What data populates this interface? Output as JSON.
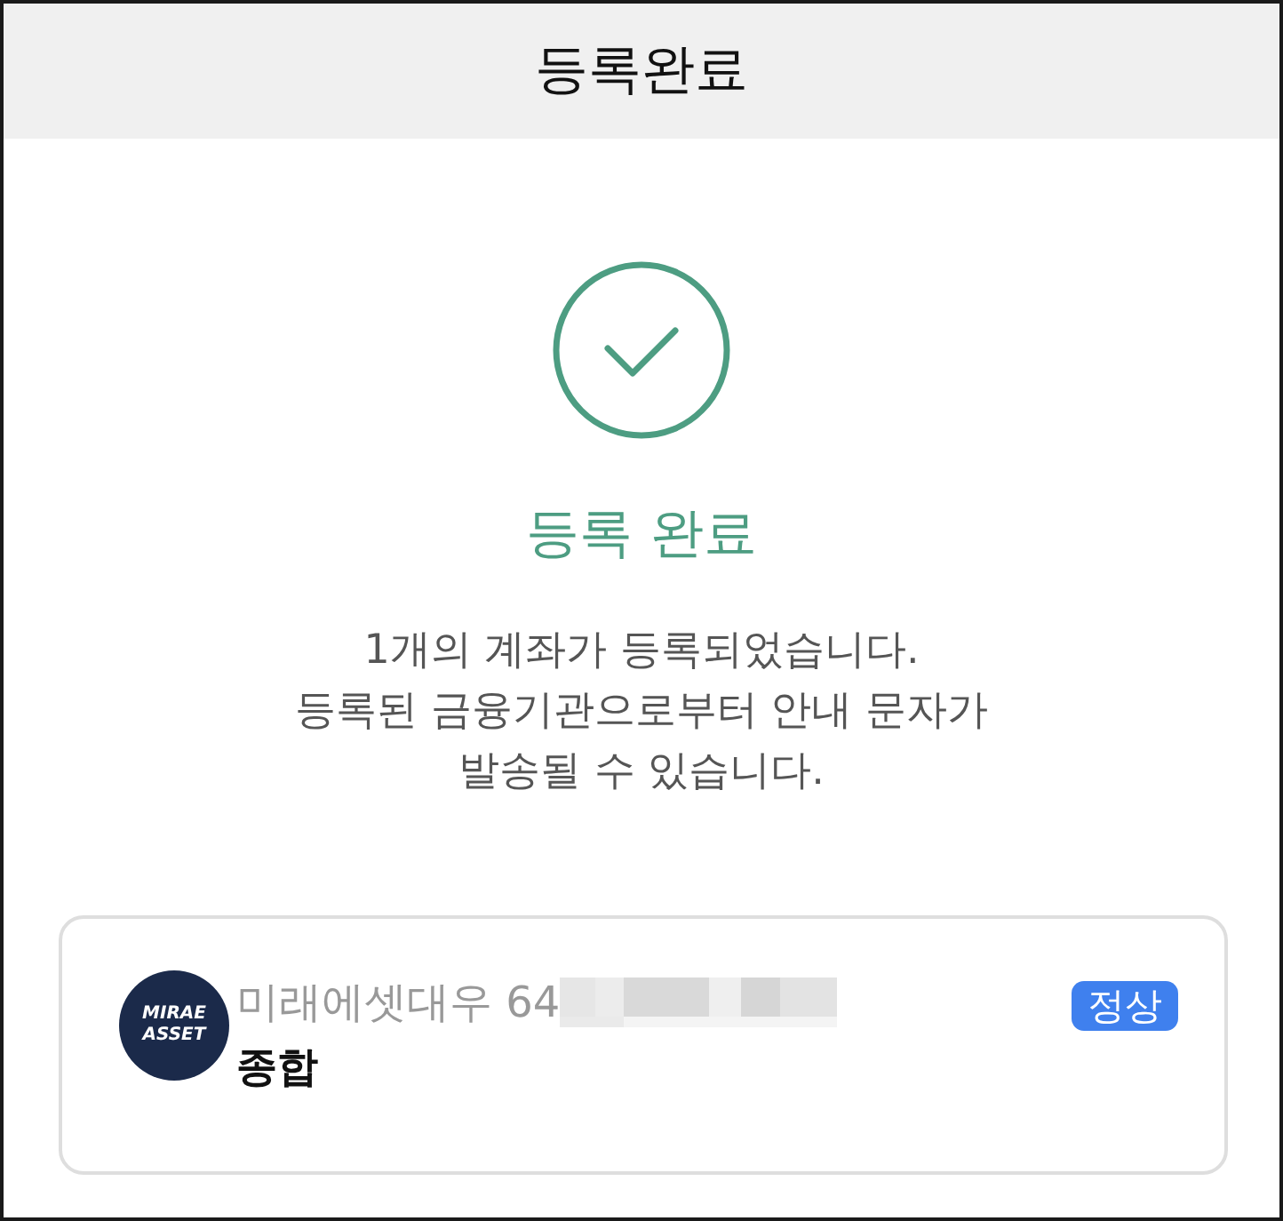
{
  "header": {
    "title": "등록완료"
  },
  "result": {
    "completed": true,
    "heading": "등록 완료",
    "message_lines": [
      "1개의 계좌가 등록되었습니다.",
      "등록된 금융기관으로부터 안내 문자가",
      "발송될 수 있습니다."
    ]
  },
  "accounts": [
    {
      "logo_lines": [
        "MIRAE",
        "ASSET"
      ],
      "institution": "미래에셋대우 64",
      "number_masked": true,
      "type": "종합",
      "status": "정상"
    }
  ]
}
